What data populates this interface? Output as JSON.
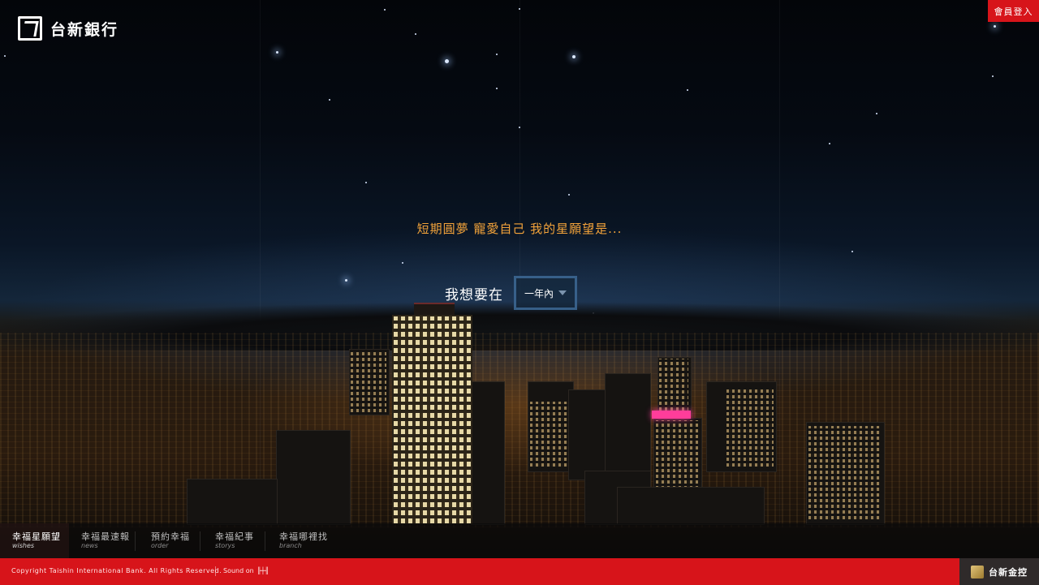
{
  "brand": {
    "name": "台新銀行",
    "logo_icon": "taishin-logo-icon"
  },
  "header": {
    "member_login": "會員登入"
  },
  "main": {
    "tagline": "短期圓夢 寵愛自己 我的星願望是...",
    "wish_label": "我想要在",
    "period_select": {
      "selected": "一年內",
      "icon": "chevron-down-icon"
    }
  },
  "nav": {
    "items": [
      {
        "zh": "幸福星願望",
        "en": "wishes",
        "active": true
      },
      {
        "zh": "幸福最速報",
        "en": "news",
        "active": false
      },
      {
        "zh": "預約幸福",
        "en": "order",
        "active": false
      },
      {
        "zh": "幸福紀事",
        "en": "storys",
        "active": false
      },
      {
        "zh": "幸福哪裡找",
        "en": "branch",
        "active": false
      }
    ]
  },
  "footer": {
    "copyright": "Copyright Taishin International Bank. All Rights Reserved.",
    "sound": "Sound on",
    "sound_icon": "sound-wave-icon",
    "holding": "台新金控",
    "holding_icon": "taishin-holding-icon"
  },
  "colors": {
    "brand_red": "#d7141a",
    "tagline_orange": "#f3a33a"
  }
}
